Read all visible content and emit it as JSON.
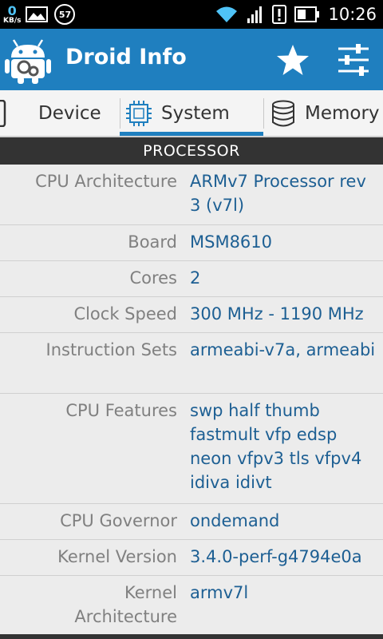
{
  "status_bar": {
    "net_speed": "0",
    "net_unit": "KB/s",
    "notification_badge": "57",
    "time": "10:26",
    "icons": [
      "gallery-icon",
      "wifi-icon",
      "signal-icon",
      "alert-icon",
      "battery-icon"
    ]
  },
  "app_bar": {
    "title": "Droid Info",
    "actions": [
      "star-icon",
      "settings-sliders-icon"
    ],
    "color": "#1f7fbf"
  },
  "tabs": [
    {
      "label": "Device",
      "icon": "phone-icon",
      "selected": false
    },
    {
      "label": "System",
      "icon": "cpu-chip-icon",
      "selected": true
    },
    {
      "label": "Memory",
      "icon": "database-icon",
      "selected": false
    }
  ],
  "section": {
    "title": "PROCESSOR"
  },
  "rows": [
    {
      "label": "CPU Architecture",
      "value": "ARMv7 Processor rev 3 (v7l)"
    },
    {
      "label": "Board",
      "value": "MSM8610"
    },
    {
      "label": "Cores",
      "value": "2"
    },
    {
      "label": "Clock Speed",
      "value": "300 MHz - 1190 MHz"
    },
    {
      "label": "Instruction Sets",
      "value": "armeabi-v7a, armeabi"
    },
    {
      "label": "CPU Features",
      "value": "swp half thumb fastmult vfp edsp neon vfpv3 tls vfpv4 idiva idivt"
    },
    {
      "label": "CPU Governor",
      "value": "ondemand"
    },
    {
      "label": "Kernel Version",
      "value": "3.4.0-perf-g4794e0a"
    },
    {
      "label": "Kernel Architecture",
      "value": "armv7l"
    }
  ],
  "colors": {
    "accent": "#1f7fbf",
    "value_text": "#1d5f93",
    "label_text": "#808080",
    "header_bg": "#333333"
  }
}
